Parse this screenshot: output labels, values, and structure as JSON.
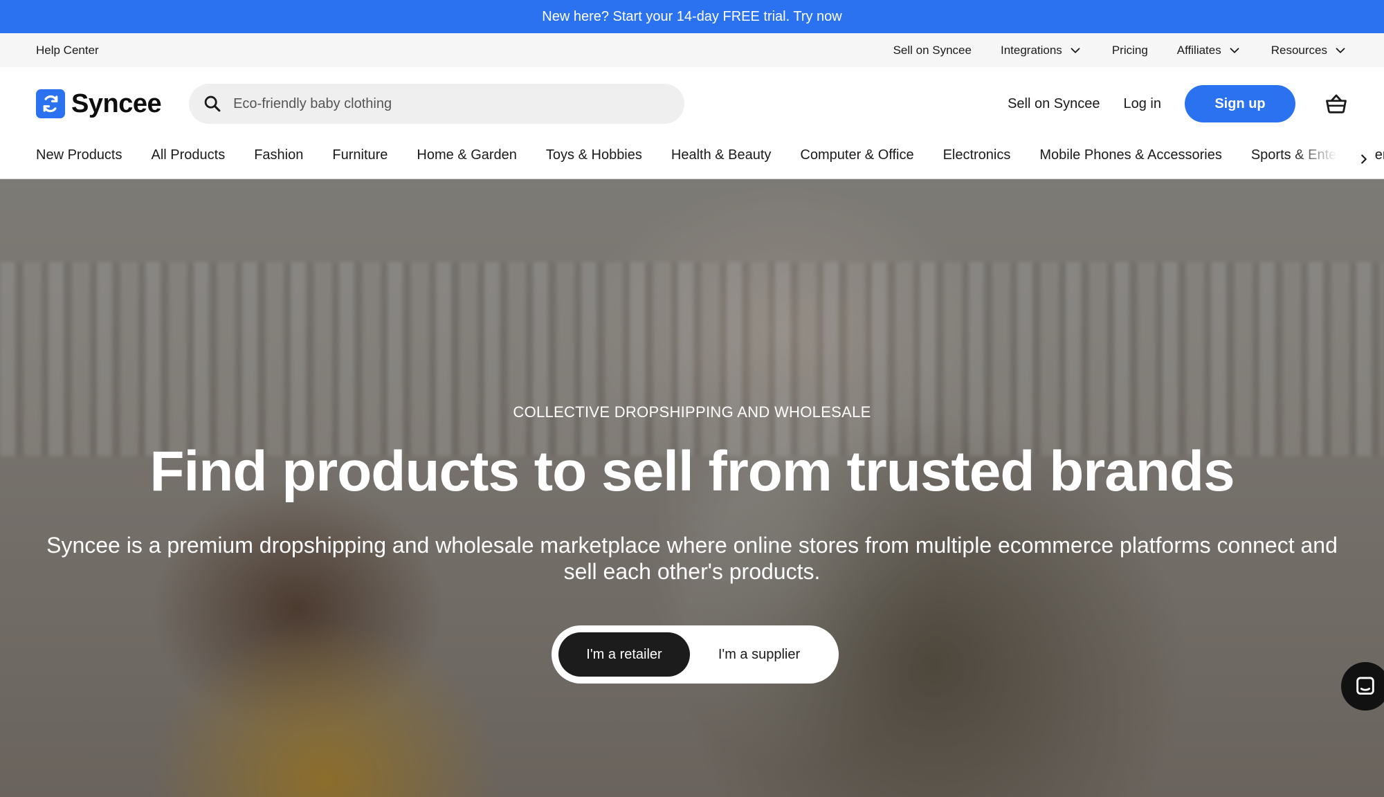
{
  "promo_bar": {
    "text": "New here? Start your 14-day FREE trial. Try now"
  },
  "utility_nav": {
    "help": "Help Center",
    "links": [
      {
        "label": "Sell on Syncee",
        "dropdown": false
      },
      {
        "label": "Integrations",
        "dropdown": true
      },
      {
        "label": "Pricing",
        "dropdown": false
      },
      {
        "label": "Affiliates",
        "dropdown": true
      },
      {
        "label": "Resources",
        "dropdown": true
      }
    ]
  },
  "header": {
    "logo_text": "Syncee",
    "search_placeholder": "Eco-friendly baby clothing",
    "sell_link": "Sell on Syncee",
    "login": "Log in",
    "signup": "Sign up",
    "cart_icon": "basket-icon"
  },
  "categories": [
    "New Products",
    "All Products",
    "Fashion",
    "Furniture",
    "Home & Garden",
    "Toys & Hobbies",
    "Health & Beauty",
    "Computer & Office",
    "Electronics",
    "Mobile Phones & Accessories",
    "Sports & Entertainment"
  ],
  "hero": {
    "eyebrow": "COLLECTIVE DROPSHIPPING AND WHOLESALE",
    "headline": "Find products to sell from trusted brands",
    "subheadline": "Syncee is a premium dropshipping and wholesale marketplace where online stores from multiple ecommerce platforms connect and sell each other's products.",
    "role_options": [
      "I'm a retailer",
      "I'm a supplier"
    ],
    "selected_role": "I'm a retailer"
  },
  "colors": {
    "brand_blue": "#2b72f0",
    "dark_button": "#1c1c1c",
    "utility_bg": "#f6f6f6"
  }
}
